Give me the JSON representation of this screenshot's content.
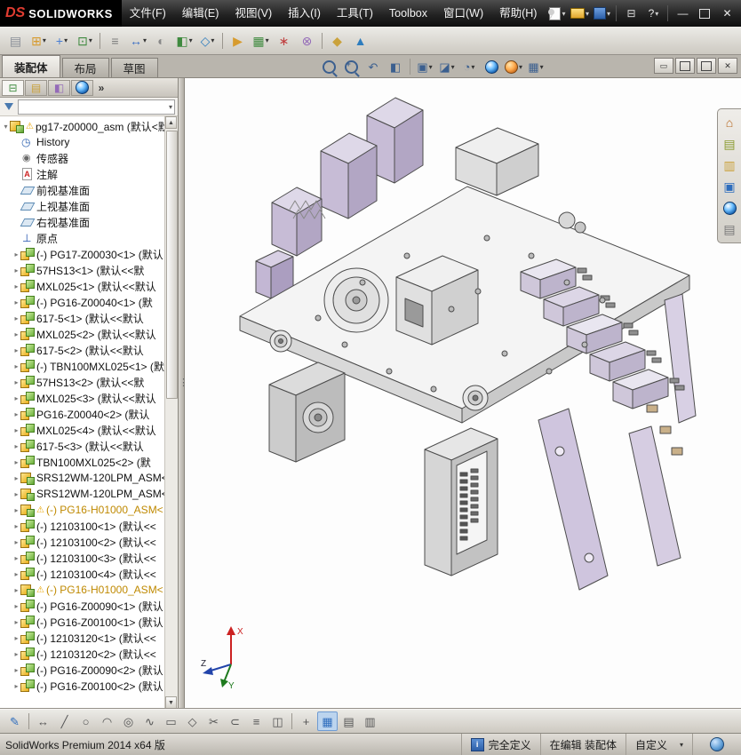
{
  "titlebar": {
    "logo_ds": "DS",
    "logo_text": "SOLIDWORKS",
    "menus": [
      {
        "name": "menu-file",
        "label": "文件(F)"
      },
      {
        "name": "menu-edit",
        "label": "编辑(E)"
      },
      {
        "name": "menu-view",
        "label": "视图(V)"
      },
      {
        "name": "menu-insert",
        "label": "插入(I)"
      },
      {
        "name": "menu-tools",
        "label": "工具(T)"
      },
      {
        "name": "menu-toolbox",
        "label": "Toolbox"
      },
      {
        "name": "menu-window",
        "label": "窗口(W)"
      },
      {
        "name": "menu-help",
        "label": "帮助(H)"
      }
    ],
    "quick_icons": [
      {
        "name": "new-document-icon",
        "kind": "doc",
        "dropdown": true
      },
      {
        "name": "open-icon",
        "kind": "folder",
        "dropdown": true
      },
      {
        "name": "save-icon",
        "kind": "disk",
        "dropdown": true
      },
      {
        "sep": true
      },
      {
        "name": "print-icon",
        "glyph": "⊟",
        "color": "#e0e0e0"
      },
      {
        "name": "help-icon",
        "glyph": "?",
        "color": "#e8e8e8",
        "dropdown": true
      },
      {
        "sep": true
      },
      {
        "name": "minimize-icon",
        "glyph": "—",
        "color": "#e8e8e8"
      },
      {
        "name": "restore-icon",
        "kind": "box"
      },
      {
        "name": "close-icon",
        "glyph": "✕",
        "color": "#e8e8e8"
      }
    ]
  },
  "assembly_toolbar": [
    {
      "name": "edit-component-icon",
      "glyph": "▤",
      "color": "#8a8f98"
    },
    {
      "name": "insert-components-icon",
      "glyph": "⊞",
      "color": "#d79b2e",
      "dropdown": true
    },
    {
      "name": "mate-icon",
      "glyph": "+",
      "color": "#4a7fd4",
      "dropdown": true
    },
    {
      "name": "linear-component-pattern-icon",
      "glyph": "⊡",
      "color": "#3f8a3f",
      "dropdown": true
    },
    {
      "sep": true
    },
    {
      "name": "smart-fasteners-icon",
      "glyph": "≡",
      "color": "#7d7d7d"
    },
    {
      "name": "move-component-icon",
      "glyph": "↔",
      "color": "#3b6fc4",
      "dropdown": true
    },
    {
      "name": "show-hidden-components-icon",
      "glyph": "◐",
      "color": "#888888"
    },
    {
      "name": "assembly-features-icon",
      "glyph": "◧",
      "color": "#3f8a3f",
      "dropdown": true
    },
    {
      "name": "reference-geometry-icon",
      "glyph": "◇",
      "color": "#2e7dbe",
      "dropdown": true
    },
    {
      "sep": true
    },
    {
      "name": "new-motion-study-icon",
      "glyph": "▶",
      "color": "#d79b2e"
    },
    {
      "name": "bill-of-materials-icon",
      "glyph": "▦",
      "color": "#3f8a3f",
      "dropdown": true
    },
    {
      "name": "exploded-view-icon",
      "glyph": "∗",
      "color": "#c04040"
    },
    {
      "name": "interference-detection-icon",
      "glyph": "⊗",
      "color": "#946bb8"
    },
    {
      "sep": true
    },
    {
      "name": "instant3d-icon",
      "glyph": "◆",
      "color": "#caa23c"
    },
    {
      "name": "simulation-icon",
      "glyph": "▲",
      "color": "#2e7dbe"
    }
  ],
  "tabs": {
    "items": [
      "装配体",
      "布局",
      "草图"
    ],
    "active": 0
  },
  "headsup_toolbar": [
    {
      "name": "zoom-fit-icon",
      "kind": "mag"
    },
    {
      "name": "zoom-area-icon",
      "kind": "mag2"
    },
    {
      "name": "previous-view-icon",
      "glyph": "↶"
    },
    {
      "name": "section-view-icon",
      "glyph": "◧"
    },
    {
      "sep": true
    },
    {
      "name": "view-orientation-icon",
      "glyph": "▣",
      "dropdown": true
    },
    {
      "name": "display-style-icon",
      "glyph": "◪",
      "dropdown": true
    },
    {
      "name": "hide-show-items-icon",
      "glyph": "◔",
      "dropdown": true
    },
    {
      "name": "edit-appearance-icon",
      "kind": "ball"
    },
    {
      "name": "apply-scene-icon",
      "kind": "ball2",
      "dropdown": true
    },
    {
      "name": "view-settings-icon",
      "glyph": "▦",
      "dropdown": true
    }
  ],
  "doc_window_buttons": [
    {
      "name": "doc-minimize-icon",
      "glyph": "▭"
    },
    {
      "name": "doc-restore-icon",
      "kind": "box"
    },
    {
      "name": "doc-tile-icon",
      "kind": "box"
    },
    {
      "name": "doc-close-icon",
      "glyph": "✕"
    }
  ],
  "panel": {
    "tabs": [
      {
        "name": "featuremanager-tab",
        "glyph": "⊟",
        "color": "#3f8a3f",
        "active": true
      },
      {
        "name": "propertymanager-tab",
        "glyph": "▤",
        "color": "#caa23c"
      },
      {
        "name": "configurationmanager-tab",
        "glyph": "◧",
        "color": "#946bb8"
      },
      {
        "name": "displaymanager-tab",
        "kind": "ball"
      }
    ],
    "overflow": "»"
  },
  "tree": {
    "items": [
      {
        "t": "pg17-z00000_asm (默认<默",
        "icon": "asm",
        "warn": true,
        "root": true
      },
      {
        "t": "History",
        "icon": "history"
      },
      {
        "t": "传感器",
        "icon": "sensors"
      },
      {
        "t": "注解",
        "icon": "ann"
      },
      {
        "t": "前视基准面",
        "icon": "plane"
      },
      {
        "t": "上视基准面",
        "icon": "plane"
      },
      {
        "t": "右视基准面",
        "icon": "plane"
      },
      {
        "t": "原点",
        "icon": "origin"
      },
      {
        "t": "(-) PG17-Z00030<1> (默认",
        "icon": "comp"
      },
      {
        "t": "57HS13<1> (默认<<默",
        "icon": "comp"
      },
      {
        "t": "MXL025<1> (默认<<默认",
        "icon": "comp"
      },
      {
        "t": "(-) PG16-Z00040<1> (默",
        "icon": "comp"
      },
      {
        "t": "617-5<1> (默认<<默认",
        "icon": "comp"
      },
      {
        "t": "MXL025<2> (默认<<默认",
        "icon": "comp"
      },
      {
        "t": "617-5<2> (默认<<默认",
        "icon": "comp"
      },
      {
        "t": "(-) TBN100MXL025<1> (默",
        "icon": "comp"
      },
      {
        "t": "57HS13<2> (默认<<默",
        "icon": "comp"
      },
      {
        "t": "MXL025<3> (默认<<默认",
        "icon": "comp"
      },
      {
        "t": "PG16-Z00040<2> (默认",
        "icon": "comp"
      },
      {
        "t": "MXL025<4> (默认<<默认",
        "icon": "comp"
      },
      {
        "t": "617-5<3> (默认<<默认",
        "icon": "comp"
      },
      {
        "t": "TBN100MXL025<2> (默",
        "icon": "comp"
      },
      {
        "t": "SRS12WM-120LPM_ASM<",
        "icon": "asm"
      },
      {
        "t": "SRS12WM-120LPM_ASM<",
        "icon": "asm"
      },
      {
        "t": "(-) PG16-H01000_ASM<",
        "icon": "asm",
        "warn": true,
        "orange": true
      },
      {
        "t": "(-) 12103100<1> (默认<<",
        "icon": "comp"
      },
      {
        "t": "(-) 12103100<2> (默认<<",
        "icon": "comp"
      },
      {
        "t": "(-) 12103100<3> (默认<<",
        "icon": "comp"
      },
      {
        "t": "(-) 12103100<4> (默认<<",
        "icon": "comp"
      },
      {
        "t": "(-) PG16-H01000_ASM<",
        "icon": "asm",
        "warn": true,
        "orange": true
      },
      {
        "t": "(-) PG16-Z00090<1> (默认",
        "icon": "comp"
      },
      {
        "t": "(-) PG16-Z00100<1> (默认",
        "icon": "comp"
      },
      {
        "t": "(-) 12103120<1> (默认<<",
        "icon": "comp"
      },
      {
        "t": "(-) 12103120<2> (默认<<",
        "icon": "comp"
      },
      {
        "t": "(-) PG16-Z00090<2> (默认",
        "icon": "comp"
      },
      {
        "t": "(-) PG16-Z00100<2> (默认",
        "icon": "comp"
      }
    ],
    "orange_color": "#bf8900"
  },
  "taskpane": [
    {
      "name": "solidworks-resources-icon",
      "glyph": "⌂",
      "color": "#b5651d"
    },
    {
      "name": "design-library-icon",
      "glyph": "▤",
      "color": "#8a9a2e"
    },
    {
      "name": "file-explorer-icon",
      "glyph": "▥",
      "color": "#caa23c"
    },
    {
      "name": "view-palette-icon",
      "glyph": "▣",
      "color": "#2e6dbd"
    },
    {
      "name": "appearances-icon",
      "kind": "ball"
    },
    {
      "name": "custom-properties-icon",
      "glyph": "▤",
      "color": "#777777"
    }
  ],
  "sketch_toolbar": [
    {
      "name": "sketch-icon",
      "glyph": "✎",
      "color": "#2e6dbd"
    },
    {
      "sep": true
    },
    {
      "name": "smart-dimension-icon",
      "glyph": "↔",
      "color": "#555555"
    },
    {
      "name": "line-icon",
      "glyph": "╱",
      "color": "#555555"
    },
    {
      "name": "circle-icon",
      "glyph": "○",
      "color": "#555555"
    },
    {
      "name": "arc-icon",
      "glyph": "◠",
      "color": "#555555"
    },
    {
      "name": "ellipse-icon",
      "glyph": "◎",
      "color": "#555555"
    },
    {
      "name": "spline-icon",
      "glyph": "∿",
      "color": "#555555"
    },
    {
      "name": "rectangle-icon",
      "glyph": "▭",
      "color": "#555555"
    },
    {
      "name": "polygon-icon",
      "glyph": "◇",
      "color": "#555555"
    },
    {
      "name": "trim-entities-icon",
      "glyph": "✂",
      "color": "#555555"
    },
    {
      "name": "convert-entities-icon",
      "glyph": "⊂",
      "color": "#555555"
    },
    {
      "name": "offset-entities-icon",
      "glyph": "≡",
      "color": "#555555"
    },
    {
      "name": "mirror-entities-icon",
      "glyph": "◫",
      "color": "#555555"
    },
    {
      "sep": true
    },
    {
      "name": "quick-snaps-icon",
      "glyph": "+",
      "color": "#555555"
    },
    {
      "name": "grid-icon",
      "glyph": "▦",
      "color": "#2e6dbd",
      "active": true
    },
    {
      "name": "section-sketch-icon",
      "glyph": "▤",
      "color": "#555555"
    },
    {
      "name": "table-icon",
      "glyph": "▥",
      "color": "#555555"
    }
  ],
  "statusbar": {
    "left": "SolidWorks Premium 2014 x64 版",
    "defined": "完全定义",
    "editing": "在编辑 装配体",
    "custom": "自定义"
  },
  "triad": {
    "x_label": "X",
    "y_label": "Y",
    "z_label": "Z",
    "x_color": "#cc2222",
    "y_color": "#1e7a1e",
    "z_color": "#2244aa"
  },
  "colors": {
    "lavender_top": "#ded8e8",
    "lavender_front": "#c7bcd6",
    "lavender_side": "#b2a6c4",
    "accent_blue": "#2e6dbd",
    "warning": "#eba600"
  }
}
